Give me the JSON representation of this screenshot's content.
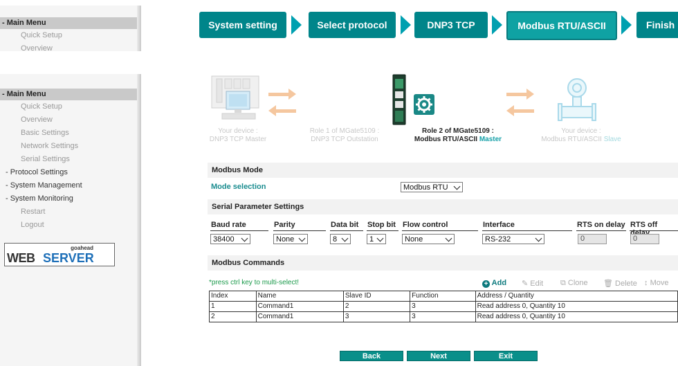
{
  "sidebar_top": {
    "header": "- Main Menu",
    "items": [
      "Quick Setup",
      "Overview"
    ]
  },
  "sidebar_main": {
    "header": "- Main Menu",
    "items": [
      "Quick Setup",
      "Overview",
      "Basic Settings",
      "Network Settings",
      "Serial Settings"
    ],
    "groups": [
      "- Protocol Settings",
      "- System Management",
      "- System Monitoring"
    ],
    "items_after": [
      "Restart",
      "Logout"
    ],
    "logo": {
      "small": "goahead",
      "web": "WEB",
      "server": "SERVER"
    }
  },
  "wizard": {
    "steps": [
      "System setting",
      "Select protocol",
      "DNP3 TCP",
      "Modbus RTU/ASCII",
      "Finish"
    ],
    "active_step": 3
  },
  "diagram": {
    "device_left": {
      "line1": "Your device :",
      "line2": "DNP3 TCP Master"
    },
    "role1": {
      "line1": "Role 1 of MGate5109 :",
      "line2": "DNP3 TCP Outstation"
    },
    "role2": {
      "line1": "Role 2 of MGate5109 :",
      "line2a": "Modbus RTU/ASCII ",
      "line2b": "Master"
    },
    "device_right": {
      "line1": "Your device :",
      "line2a": "Modbus RTU/ASCII ",
      "line2b": "Slave"
    }
  },
  "modbus_mode": {
    "title": "Modbus Mode",
    "label": "Mode selection",
    "value": "Modbus RTU"
  },
  "serial": {
    "title": "Serial Parameter Settings",
    "headers": [
      "Baud rate",
      "Parity",
      "Data bit",
      "Stop bit",
      "Flow control",
      "Interface",
      "RTS on delay",
      "RTS off delay"
    ],
    "baud": "38400",
    "parity": "None",
    "data_bit": "8",
    "stop_bit": "1",
    "flow": "None",
    "interface": "RS-232",
    "rts_on": "0",
    "rts_off": "0"
  },
  "commands": {
    "title": "Modbus Commands",
    "hint": "*press ctrl key to multi-select!",
    "tools": {
      "add": "Add",
      "edit": "Edit",
      "clone": "Clone",
      "delete": "Delete",
      "move": "Move"
    },
    "columns": [
      "Index",
      "Name",
      "Slave ID",
      "Function",
      "Address / Quantity"
    ],
    "rows": [
      [
        "1",
        "Command1",
        "2",
        "3",
        "Read address 0, Quantity 10"
      ],
      [
        "2",
        "Command1",
        "3",
        "3",
        "Read address 0, Quantity 10"
      ]
    ]
  },
  "buttons": {
    "back": "Back",
    "next": "Next",
    "exit": "Exit"
  },
  "colors": {
    "teal": "#00858a",
    "active_step": "#0fa2a3",
    "arrow": "#00a0b0",
    "diagram_arrow": "#f5c79f"
  }
}
